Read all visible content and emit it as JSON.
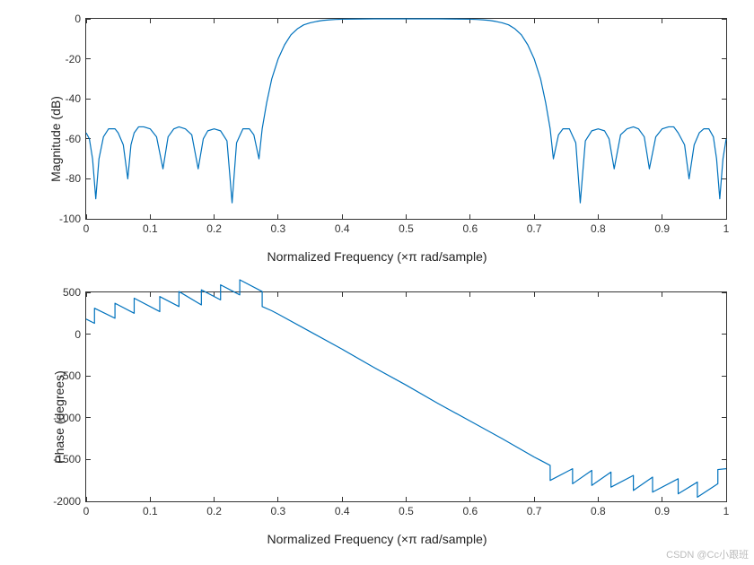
{
  "watermark": "CSDN @Cc小跟班",
  "chart_data": [
    {
      "type": "line",
      "ylabel": "Magnitude (dB)",
      "xlabel": "Normalized Frequency  (×π rad/sample)",
      "xlim": [
        0,
        1
      ],
      "ylim": [
        -100,
        0
      ],
      "xticks": [
        0,
        0.1,
        0.2,
        0.3,
        0.4,
        0.5,
        0.6,
        0.7,
        0.8,
        0.9,
        1
      ],
      "yticks": [
        -100,
        -80,
        -60,
        -40,
        -20,
        0
      ],
      "series": [
        {
          "name": "Magnitude",
          "color": "#0072BD",
          "x": [
            0,
            0.005,
            0.01,
            0.015,
            0.02,
            0.027,
            0.035,
            0.045,
            0.05,
            0.058,
            0.065,
            0.07,
            0.075,
            0.082,
            0.09,
            0.1,
            0.11,
            0.12,
            0.128,
            0.137,
            0.145,
            0.155,
            0.165,
            0.175,
            0.183,
            0.19,
            0.2,
            0.21,
            0.22,
            0.228,
            0.235,
            0.245,
            0.255,
            0.262,
            0.27,
            0.275,
            0.282,
            0.29,
            0.3,
            0.31,
            0.32,
            0.33,
            0.34,
            0.35,
            0.36,
            0.37,
            0.38,
            0.39,
            0.4,
            0.42,
            0.45,
            0.5,
            0.55,
            0.58,
            0.6,
            0.61,
            0.62,
            0.63,
            0.64,
            0.65,
            0.66,
            0.67,
            0.68,
            0.69,
            0.7,
            0.71,
            0.718,
            0.725,
            0.73,
            0.738,
            0.745,
            0.755,
            0.765,
            0.772,
            0.78,
            0.79,
            0.8,
            0.81,
            0.817,
            0.825,
            0.835,
            0.845,
            0.855,
            0.863,
            0.872,
            0.88,
            0.89,
            0.9,
            0.91,
            0.918,
            0.925,
            0.935,
            0.942,
            0.95,
            0.958,
            0.965,
            0.973,
            0.98,
            0.985,
            0.99,
            0.995,
            1.0
          ],
          "y": [
            -57,
            -60,
            -70,
            -90,
            -70,
            -59,
            -55,
            -55,
            -57,
            -63,
            -80,
            -63,
            -57,
            -54,
            -54,
            -55,
            -59,
            -75,
            -59,
            -55,
            -54,
            -55,
            -58,
            -75,
            -60,
            -56,
            -55,
            -56,
            -61,
            -92,
            -62,
            -55,
            -55,
            -58,
            -70,
            -55,
            -42,
            -30,
            -20,
            -13,
            -8,
            -5,
            -3,
            -2,
            -1.3,
            -0.8,
            -0.5,
            -0.3,
            -0.2,
            -0.1,
            0,
            0,
            0,
            -0.1,
            -0.2,
            -0.3,
            -0.5,
            -0.8,
            -1.3,
            -2,
            -3,
            -5,
            -8,
            -13,
            -20,
            -30,
            -42,
            -55,
            -70,
            -58,
            -55,
            -55,
            -62,
            -92,
            -61,
            -56,
            -55,
            -56,
            -60,
            -75,
            -58,
            -55,
            -54,
            -55,
            -59,
            -75,
            -59,
            -55,
            -54,
            -54,
            -57,
            -63,
            -80,
            -63,
            -57,
            -55,
            -55,
            -59,
            -70,
            -90,
            -70,
            -60
          ]
        }
      ]
    },
    {
      "type": "line",
      "ylabel": "Phase (degrees)",
      "xlabel": "Normalized Frequency  (×π rad/sample)",
      "xlim": [
        0,
        1
      ],
      "ylim": [
        -2000,
        500
      ],
      "xticks": [
        0,
        0.1,
        0.2,
        0.3,
        0.4,
        0.5,
        0.6,
        0.7,
        0.8,
        0.9,
        1
      ],
      "yticks": [
        -2000,
        -1500,
        -1000,
        -500,
        0,
        500
      ],
      "series": [
        {
          "name": "Phase",
          "color": "#0072BD",
          "x": [
            0,
            0.013,
            0.013,
            0.045,
            0.045,
            0.075,
            0.075,
            0.115,
            0.115,
            0.145,
            0.145,
            0.18,
            0.18,
            0.21,
            0.21,
            0.24,
            0.24,
            0.275,
            0.275,
            0.29,
            0.3,
            0.35,
            0.4,
            0.45,
            0.5,
            0.55,
            0.6,
            0.65,
            0.7,
            0.71,
            0.725,
            0.725,
            0.76,
            0.76,
            0.79,
            0.79,
            0.82,
            0.82,
            0.855,
            0.855,
            0.885,
            0.885,
            0.925,
            0.925,
            0.955,
            0.955,
            0.987,
            0.987,
            1.0
          ],
          "y": [
            180,
            130,
            310,
            190,
            370,
            250,
            430,
            270,
            450,
            330,
            510,
            350,
            530,
            410,
            590,
            470,
            650,
            510,
            330,
            280,
            240,
            30,
            -180,
            -400,
            -610,
            -830,
            -1040,
            -1250,
            -1470,
            -1510,
            -1570,
            -1750,
            -1610,
            -1790,
            -1630,
            -1810,
            -1650,
            -1830,
            -1690,
            -1870,
            -1710,
            -1890,
            -1730,
            -1910,
            -1770,
            -1950,
            -1790,
            -1620,
            -1610
          ]
        }
      ]
    }
  ]
}
